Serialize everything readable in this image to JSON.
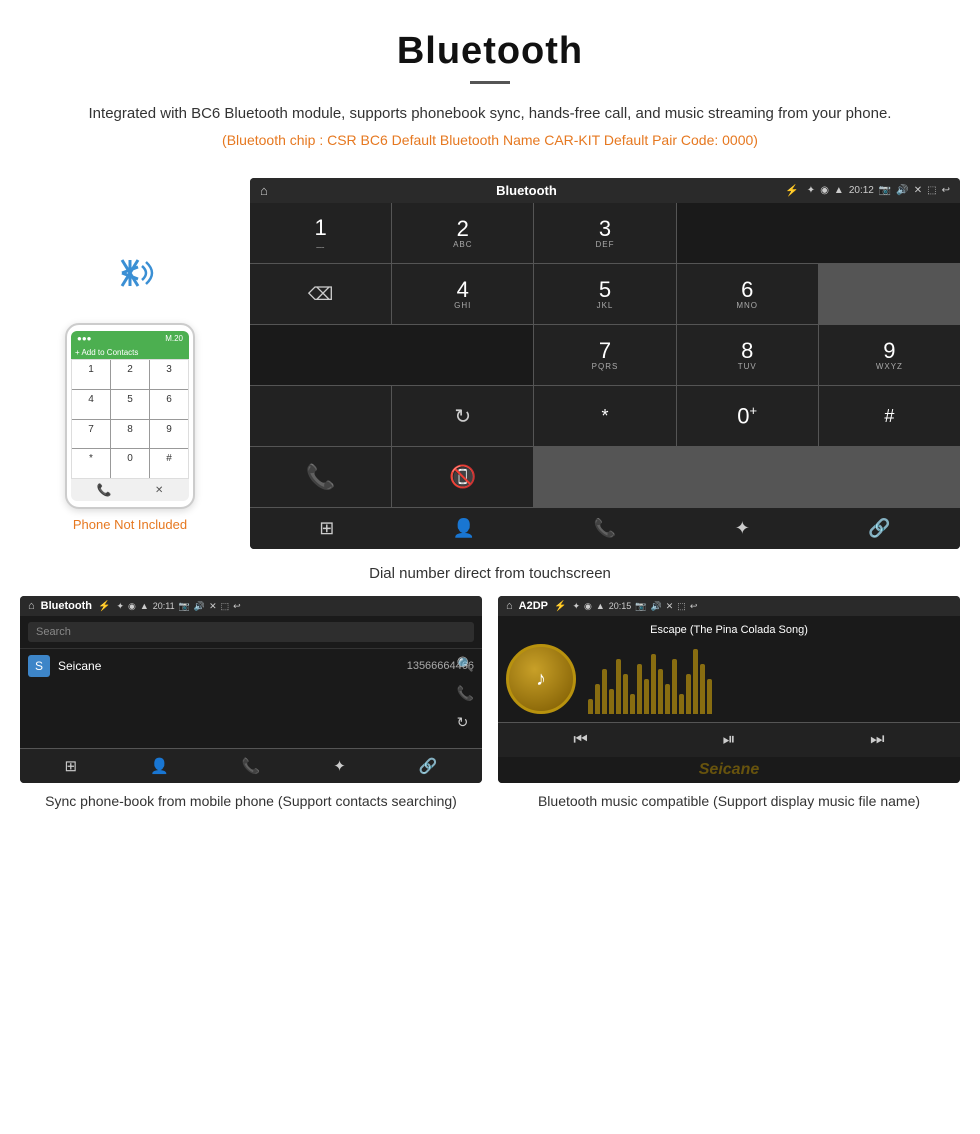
{
  "header": {
    "title": "Bluetooth",
    "description": "Integrated with BC6 Bluetooth module, supports phonebook sync, hands-free call, and music streaming from your phone.",
    "specs": "(Bluetooth chip : CSR BC6    Default Bluetooth Name CAR-KIT    Default Pair Code: 0000)"
  },
  "phone": {
    "not_included_label": "Phone Not Included",
    "top_bar_text": "M.20",
    "add_contacts": "Add to Contacts",
    "keys": [
      "1",
      "2",
      "3",
      "4",
      "5",
      "6",
      "7",
      "8",
      "9",
      "*",
      "0",
      "#"
    ]
  },
  "car_screen": {
    "title": "Bluetooth",
    "time": "20:12",
    "keys": [
      {
        "num": "1",
        "sub": ""
      },
      {
        "num": "2",
        "sub": "ABC"
      },
      {
        "num": "3",
        "sub": "DEF"
      },
      {
        "num": "4",
        "sub": "GHI"
      },
      {
        "num": "5",
        "sub": "JKL"
      },
      {
        "num": "6",
        "sub": "MNO"
      },
      {
        "num": "7",
        "sub": "PQRS"
      },
      {
        "num": "8",
        "sub": "TUV"
      },
      {
        "num": "9",
        "sub": "WXYZ"
      },
      {
        "num": "*",
        "sub": ""
      },
      {
        "num": "0",
        "sub": "+"
      },
      {
        "num": "#",
        "sub": ""
      }
    ]
  },
  "main_caption": "Dial number direct from touchscreen",
  "phonebook_screen": {
    "title": "Bluetooth",
    "time": "20:11",
    "search_placeholder": "Search",
    "contact_letter": "S",
    "contact_name": "Seicane",
    "contact_number": "13566664466"
  },
  "music_screen": {
    "title": "A2DP",
    "time": "20:15",
    "song_title": "Escape (The Pina Colada Song)"
  },
  "bottom_captions": {
    "left": "Sync phone-book from mobile phone\n(Support contacts searching)",
    "right": "Bluetooth music compatible\n(Support display music file name)"
  },
  "watermark": "Seicane"
}
